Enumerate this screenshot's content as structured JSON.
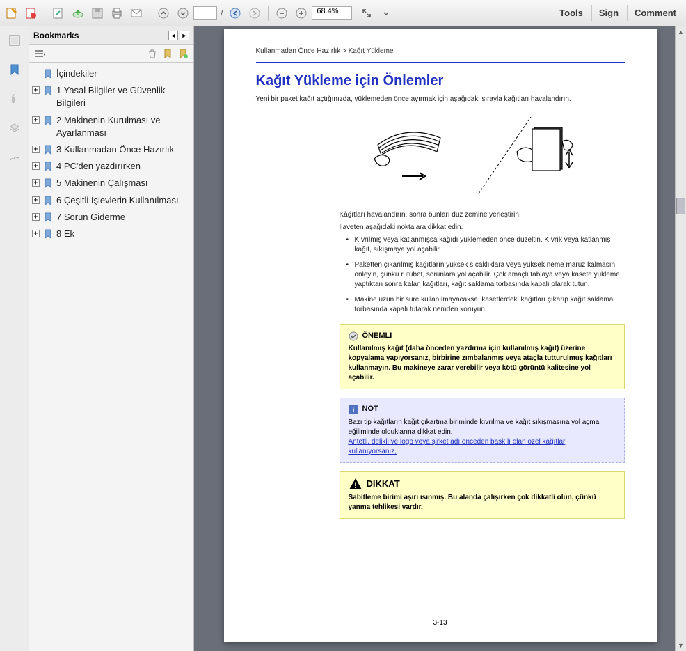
{
  "toolbar": {
    "page_current": "",
    "page_sep": "/",
    "zoom": "68.4%",
    "tools": "Tools",
    "sign": "Sign",
    "comment": "Comment"
  },
  "bookmarks": {
    "title": "Bookmarks",
    "items": [
      {
        "label": "İçindekiler",
        "expandable": false
      },
      {
        "label": "1 Yasal Bilgiler ve Güvenlik Bilgileri",
        "expandable": true
      },
      {
        "label": "2 Makinenin Kurulması ve Ayarlanması",
        "expandable": true
      },
      {
        "label": "3 Kullanmadan Önce Hazırlık",
        "expandable": true
      },
      {
        "label": "4 PC'den yazdırırken",
        "expandable": true
      },
      {
        "label": "5 Makinenin Çalışması",
        "expandable": true
      },
      {
        "label": "6 Çeşitli İşlevlerin Kullanılması",
        "expandable": true
      },
      {
        "label": "7 Sorun Giderme",
        "expandable": true
      },
      {
        "label": "8 Ek",
        "expandable": true
      }
    ]
  },
  "page": {
    "breadcrumb": "Kullanmadan Önce Hazırlık > Kağıt Yükleme",
    "title": "Kağıt Yükleme için Önlemler",
    "intro": "Yeni bir paket kağıt açtığınızda, yüklemeden önce ayırmak için aşağıdaki sırayla kağıtları havalandırın.",
    "para2": "Kâğıtları havalandırın, sonra bunları düz zemine yerleştirin.",
    "para3": "İlaveten aşağıdaki noktalara dikkat edin.",
    "bullets": [
      "Kıvrılmış veya katlanmışsa kağıdı yüklemeden önce düzeltin. Kıvrık veya katlanmış kağıt, sıkışmaya yol açabilir.",
      "Paketten çıkarılmış kağıtların yüksek sıcaklıklara veya yüksek neme maruz kalmasını önleyin, çünkü rutubet, sorunlara yol açabilir. Çok amaçlı tablaya veya kasete yükleme yaptıktan sonra kalan kağıtları, kağıt saklama torbasında kapalı olarak tutun.",
      "Makine uzun bir süre kullanılmayacaksa, kasetlerdeki kağıtları çıkarıp kağıt saklama torbasında kapalı tutarak nemden koruyun."
    ],
    "important": {
      "title": "ÖNEMLI",
      "body": "Kullanılmış kağıt (daha önceden yazdırma için kullanılmış kağıt) üzerine kopyalama yapıyorsanız, birbirine zımbalanmış veya ataçla tutturulmuş kağıtları kullanmayın. Bu makineye zarar verebilir veya kötü görüntü kalitesine yol açabilir."
    },
    "note": {
      "title": "NOT",
      "body1": "Bazı tip kağıtların kağıt çıkartma biriminde kıvrılma ve kağıt sıkışmasına yol açma eğiliminde olduklarına dikkat edin.",
      "body2": "Antetli, delikli ve logo veya şirket adı önceden baskılı olan özel kağıtlar kullanıyorsanız,"
    },
    "caution": {
      "title": "DIKKAT",
      "body": "Sabitleme birimi aşırı ısınmış. Bu alanda çalışırken çok dikkatli olun, çünkü yanma tehlikesi vardır."
    },
    "number": "3-13"
  }
}
